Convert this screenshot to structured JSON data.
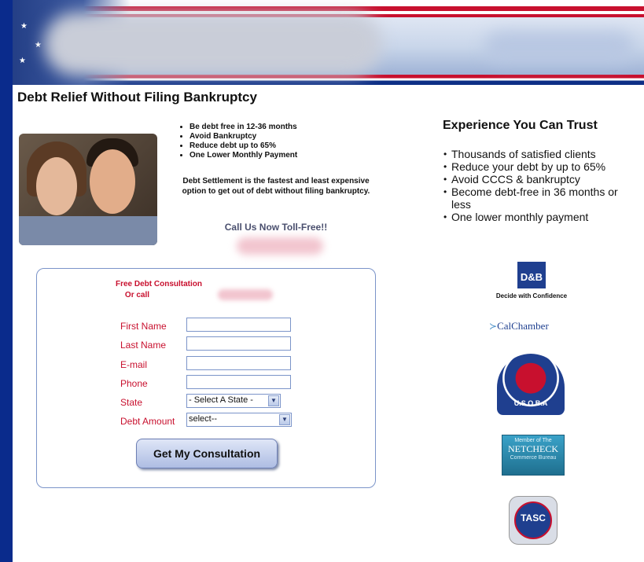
{
  "header": {
    "title": "Debt Relief Without Filing Bankruptcy"
  },
  "intro": {
    "bullets": [
      "Be debt free in 12-36 months",
      "Avoid Bankruptcy",
      "Reduce debt up to 65%",
      "One Lower Monthly Payment"
    ],
    "description": "Debt Settlement is the fastest and least expensive option to get out of debt without filing bankruptcy.",
    "call_text": "Call Us Now Toll-Free!!"
  },
  "form": {
    "title": "Free Debt Consultation",
    "or_call": "Or call",
    "fields": {
      "first_name": "First Name",
      "last_name": "Last Name",
      "email": "E-mail",
      "phone": "Phone",
      "state": "State",
      "debt_amount": "Debt Amount"
    },
    "state_selected": "- Select A State -",
    "debt_selected": "select--",
    "submit_label": "Get My Consultation"
  },
  "trust": {
    "title": "Experience You Can Trust",
    "items": [
      "Thousands of satisfied clients",
      "Reduce your debt by up to 65%",
      "Avoid CCCS & bankruptcy",
      "Become debt-free in 36 months or less",
      "One lower monthly payment"
    ]
  },
  "logos": {
    "db": {
      "name": "D&B",
      "caption": "Decide with Confidence"
    },
    "calchamber": {
      "name": "CalChamber"
    },
    "usoba": {
      "name": "U.S.O.B.A"
    },
    "netcheck": {
      "line1": "Member of The",
      "line2": "NETCHECK",
      "line3": "Commerce Bureau"
    },
    "tasc": {
      "name": "TASC"
    }
  },
  "colors": {
    "accent_red": "#c8102e",
    "navy": "#0a2b8c",
    "border_blue": "#7b94c9"
  }
}
